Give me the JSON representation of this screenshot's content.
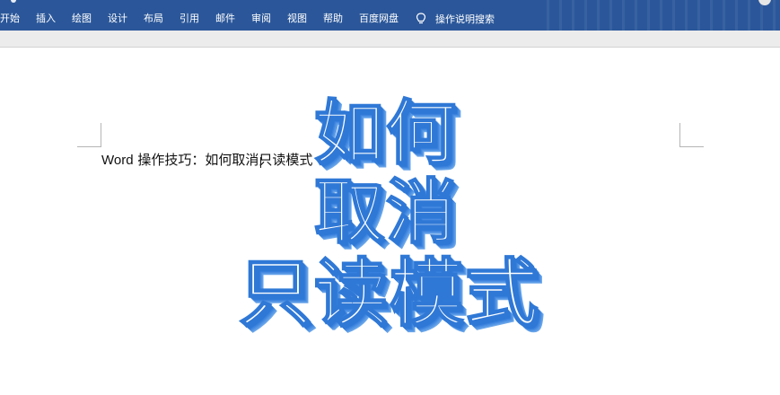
{
  "ribbon": {
    "tabs": [
      {
        "label": "开始"
      },
      {
        "label": "插入"
      },
      {
        "label": "绘图"
      },
      {
        "label": "设计"
      },
      {
        "label": "布局"
      },
      {
        "label": "引用"
      },
      {
        "label": "邮件"
      },
      {
        "label": "审阅"
      },
      {
        "label": "视图"
      },
      {
        "label": "帮助"
      },
      {
        "label": "百度网盘"
      }
    ],
    "tell_me": "操作说明搜索",
    "color": "#2b579a"
  },
  "document": {
    "text_latin": "Word",
    "text_body": " 操作技巧：如何取消只读模式"
  },
  "overlay": {
    "line1": "如何",
    "line2": "取消",
    "line3": "只读模式",
    "stroke_color": "#2f78d6"
  }
}
